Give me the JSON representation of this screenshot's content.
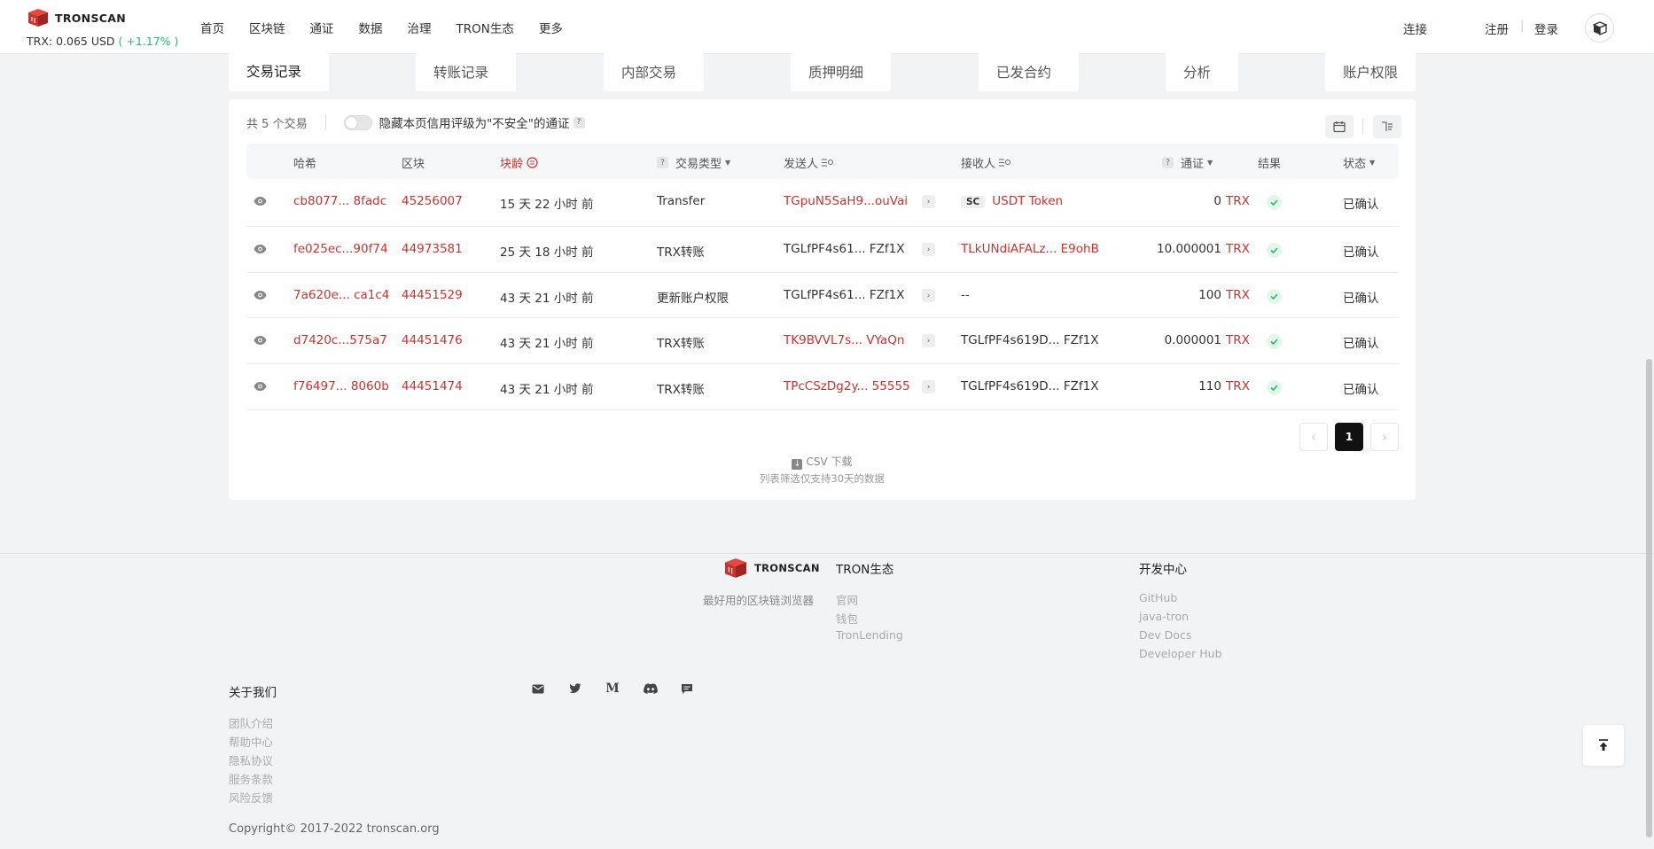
{
  "header": {
    "logo_text": "TRONSCAN",
    "price_label": "TRX: 0.065 USD",
    "price_change": "( +1.17% )",
    "nav": [
      "首页",
      "区块链",
      "通证",
      "数据",
      "治理",
      "TRON生态",
      "更多"
    ],
    "connect": "连接",
    "register": "注册",
    "sep": "|",
    "login": "登录"
  },
  "tabs": [
    "交易记录",
    "转账记录",
    "内部交易",
    "质押明细",
    "已发合约",
    "分析",
    "账户权限"
  ],
  "toolbar": {
    "count_prefix": "共",
    "count": "5",
    "count_suffix": "个交易",
    "hide_label": "隐藏本页信用评级为\"不安全\"的通证",
    "q": "?"
  },
  "columns": {
    "hash": "哈希",
    "block": "区块",
    "age": "块龄",
    "type": "交易类型",
    "from": "发送人",
    "to": "接收人",
    "token": "通证",
    "result": "结果",
    "status": "状态"
  },
  "rows": [
    {
      "hash": "cb8077... 8fadc",
      "block": "45256007",
      "age": "15 天 22 小时 前",
      "type": "Transfer",
      "from": "TGpuN5SaH9...ouVai",
      "from_red": true,
      "to": "USDT Token",
      "to_red": true,
      "to_sc": "SC",
      "amount": "0",
      "token": "TRX",
      "status": "已确认"
    },
    {
      "hash": "fe025ec...90f74",
      "block": "44973581",
      "age": "25 天 18 小时 前",
      "type": "TRX转账",
      "from": "TGLfPF4s61... FZf1X",
      "from_red": false,
      "to": "TLkUNdiAFALz... E9ohB",
      "to_red": true,
      "to_sc": "",
      "amount": "10.000001",
      "token": "TRX",
      "status": "已确认"
    },
    {
      "hash": "7a620e... ca1c4",
      "block": "44451529",
      "age": "43 天 21 小时 前",
      "type": "更新账户权限",
      "from": "TGLfPF4s61... FZf1X",
      "from_red": false,
      "to": "--",
      "to_red": false,
      "to_sc": "",
      "amount": "100",
      "token": "TRX",
      "status": "已确认"
    },
    {
      "hash": "d7420c...575a7",
      "block": "44451476",
      "age": "43 天 21 小时 前",
      "type": "TRX转账",
      "from": "TK9BVVL7s... VYaQn",
      "from_red": true,
      "to": "TGLfPF4s619D... FZf1X",
      "to_red": false,
      "to_sc": "",
      "amount": "0.000001",
      "token": "TRX",
      "status": "已确认"
    },
    {
      "hash": "f76497... 8060b",
      "block": "44451474",
      "age": "43 天 21 小时 前",
      "type": "TRX转账",
      "from": "TPcCSzDg2y... 55555",
      "from_red": true,
      "to": "TGLfPF4s619D... FZf1X",
      "to_red": false,
      "to_sc": "",
      "amount": "110",
      "token": "TRX",
      "status": "已确认"
    }
  ],
  "pagination": {
    "prev": "‹",
    "current": "1",
    "next": "›"
  },
  "csv": {
    "label": "CSV 下载",
    "note": "列表筛选仅支持30天的数据"
  },
  "footer": {
    "logo_text": "TRONSCAN",
    "slogan": "最好用的区块链浏览器",
    "eco_title": "TRON生态",
    "eco_links": [
      "官网",
      "钱包",
      "TronLending"
    ],
    "dev_title": "开发中心",
    "dev_links": [
      "GitHub",
      "java-tron",
      "Dev Docs",
      "Developer Hub"
    ],
    "about_title": "关于我们",
    "about_links": [
      "团队介绍",
      "帮助中心",
      "隐私协议",
      "服务条款",
      "风险反馈"
    ],
    "social": [
      "mail-icon",
      "twitter-icon",
      "medium-icon",
      "discord-icon",
      "chat-icon"
    ],
    "copyright": "Copyright© 2017-2022 tronscan.org"
  },
  "colors": {
    "accent": "#c23631",
    "success": "#2bb673"
  }
}
